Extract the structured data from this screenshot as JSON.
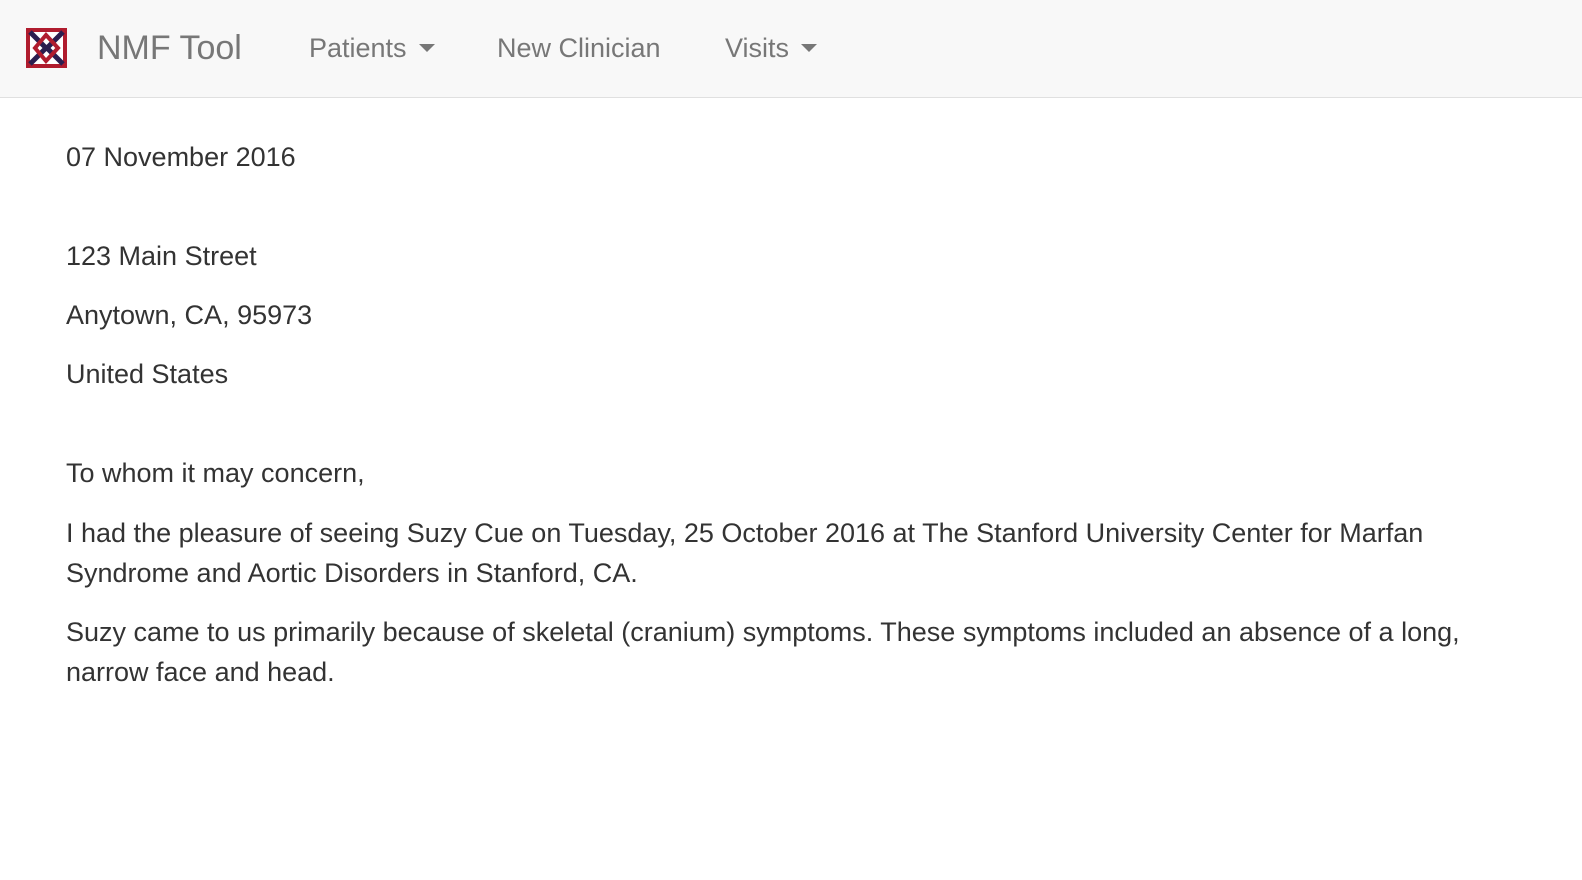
{
  "navbar": {
    "brand": "NMF Tool",
    "logo_icon": "nmf-logo-icon",
    "items": [
      {
        "label": "Patients",
        "dropdown": true
      },
      {
        "label": "New Clinician",
        "dropdown": false
      },
      {
        "label": "Visits",
        "dropdown": true
      }
    ],
    "colors": {
      "background": "#f8f8f8",
      "text": "#777777",
      "logo_red": "#b01c2e",
      "logo_navy": "#2b1e4f"
    }
  },
  "letter": {
    "date": "07 November 2016",
    "address": {
      "street": "123 Main Street",
      "city_line": "Anytown, CA, 95973",
      "country": "United States"
    },
    "salutation": "To whom it may concern,",
    "paragraphs": [
      "I had the pleasure of seeing Suzy Cue on Tuesday, 25 October 2016 at The Stanford University Center for Marfan Syndrome and Aortic Disorders in Stanford, CA.",
      "Suzy came to us primarily because of skeletal (cranium) symptoms. These symptoms included an absence of a long, narrow face and head."
    ]
  }
}
